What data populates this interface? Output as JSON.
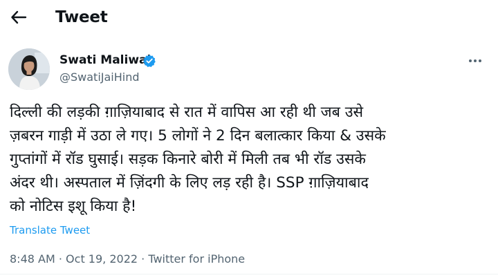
{
  "header": {
    "back_icon": "arrow-left-icon",
    "title": "Tweet"
  },
  "author": {
    "name": "Swati Maliwal",
    "handle": "@SwatiJaiHind",
    "verified_icon": "verified-badge-icon",
    "verified_color": "#1d9bf0"
  },
  "menu": {
    "more_icon": "more-options-icon"
  },
  "tweet": {
    "lines": [
      "दिल्ली की लड़की ग़ाज़ियाबाद से रात में वापिस आ रही थी जब उसे",
      "ज़बरन गाड़ी में उठा ले गए। 5 लोगों ने 2 दिन बलात्कार किया & उसके",
      "गुप्तांगों में रॉड घुसाई। सड़क किनारे बोरी में मिली तब भी रॉड उसके",
      "अंदर थी। अस्पताल में ज़िंदगी के लिए लड़ रही है। SSP ग़ाज़ियाबाद",
      "को नोटिस इशू किया है!"
    ],
    "translate_label": "Translate Tweet",
    "link_color": "#1d9bf0"
  },
  "meta": {
    "time": "8:48 AM",
    "separator": "·",
    "date": "Oct 19, 2022",
    "source": "Twitter for iPhone"
  }
}
